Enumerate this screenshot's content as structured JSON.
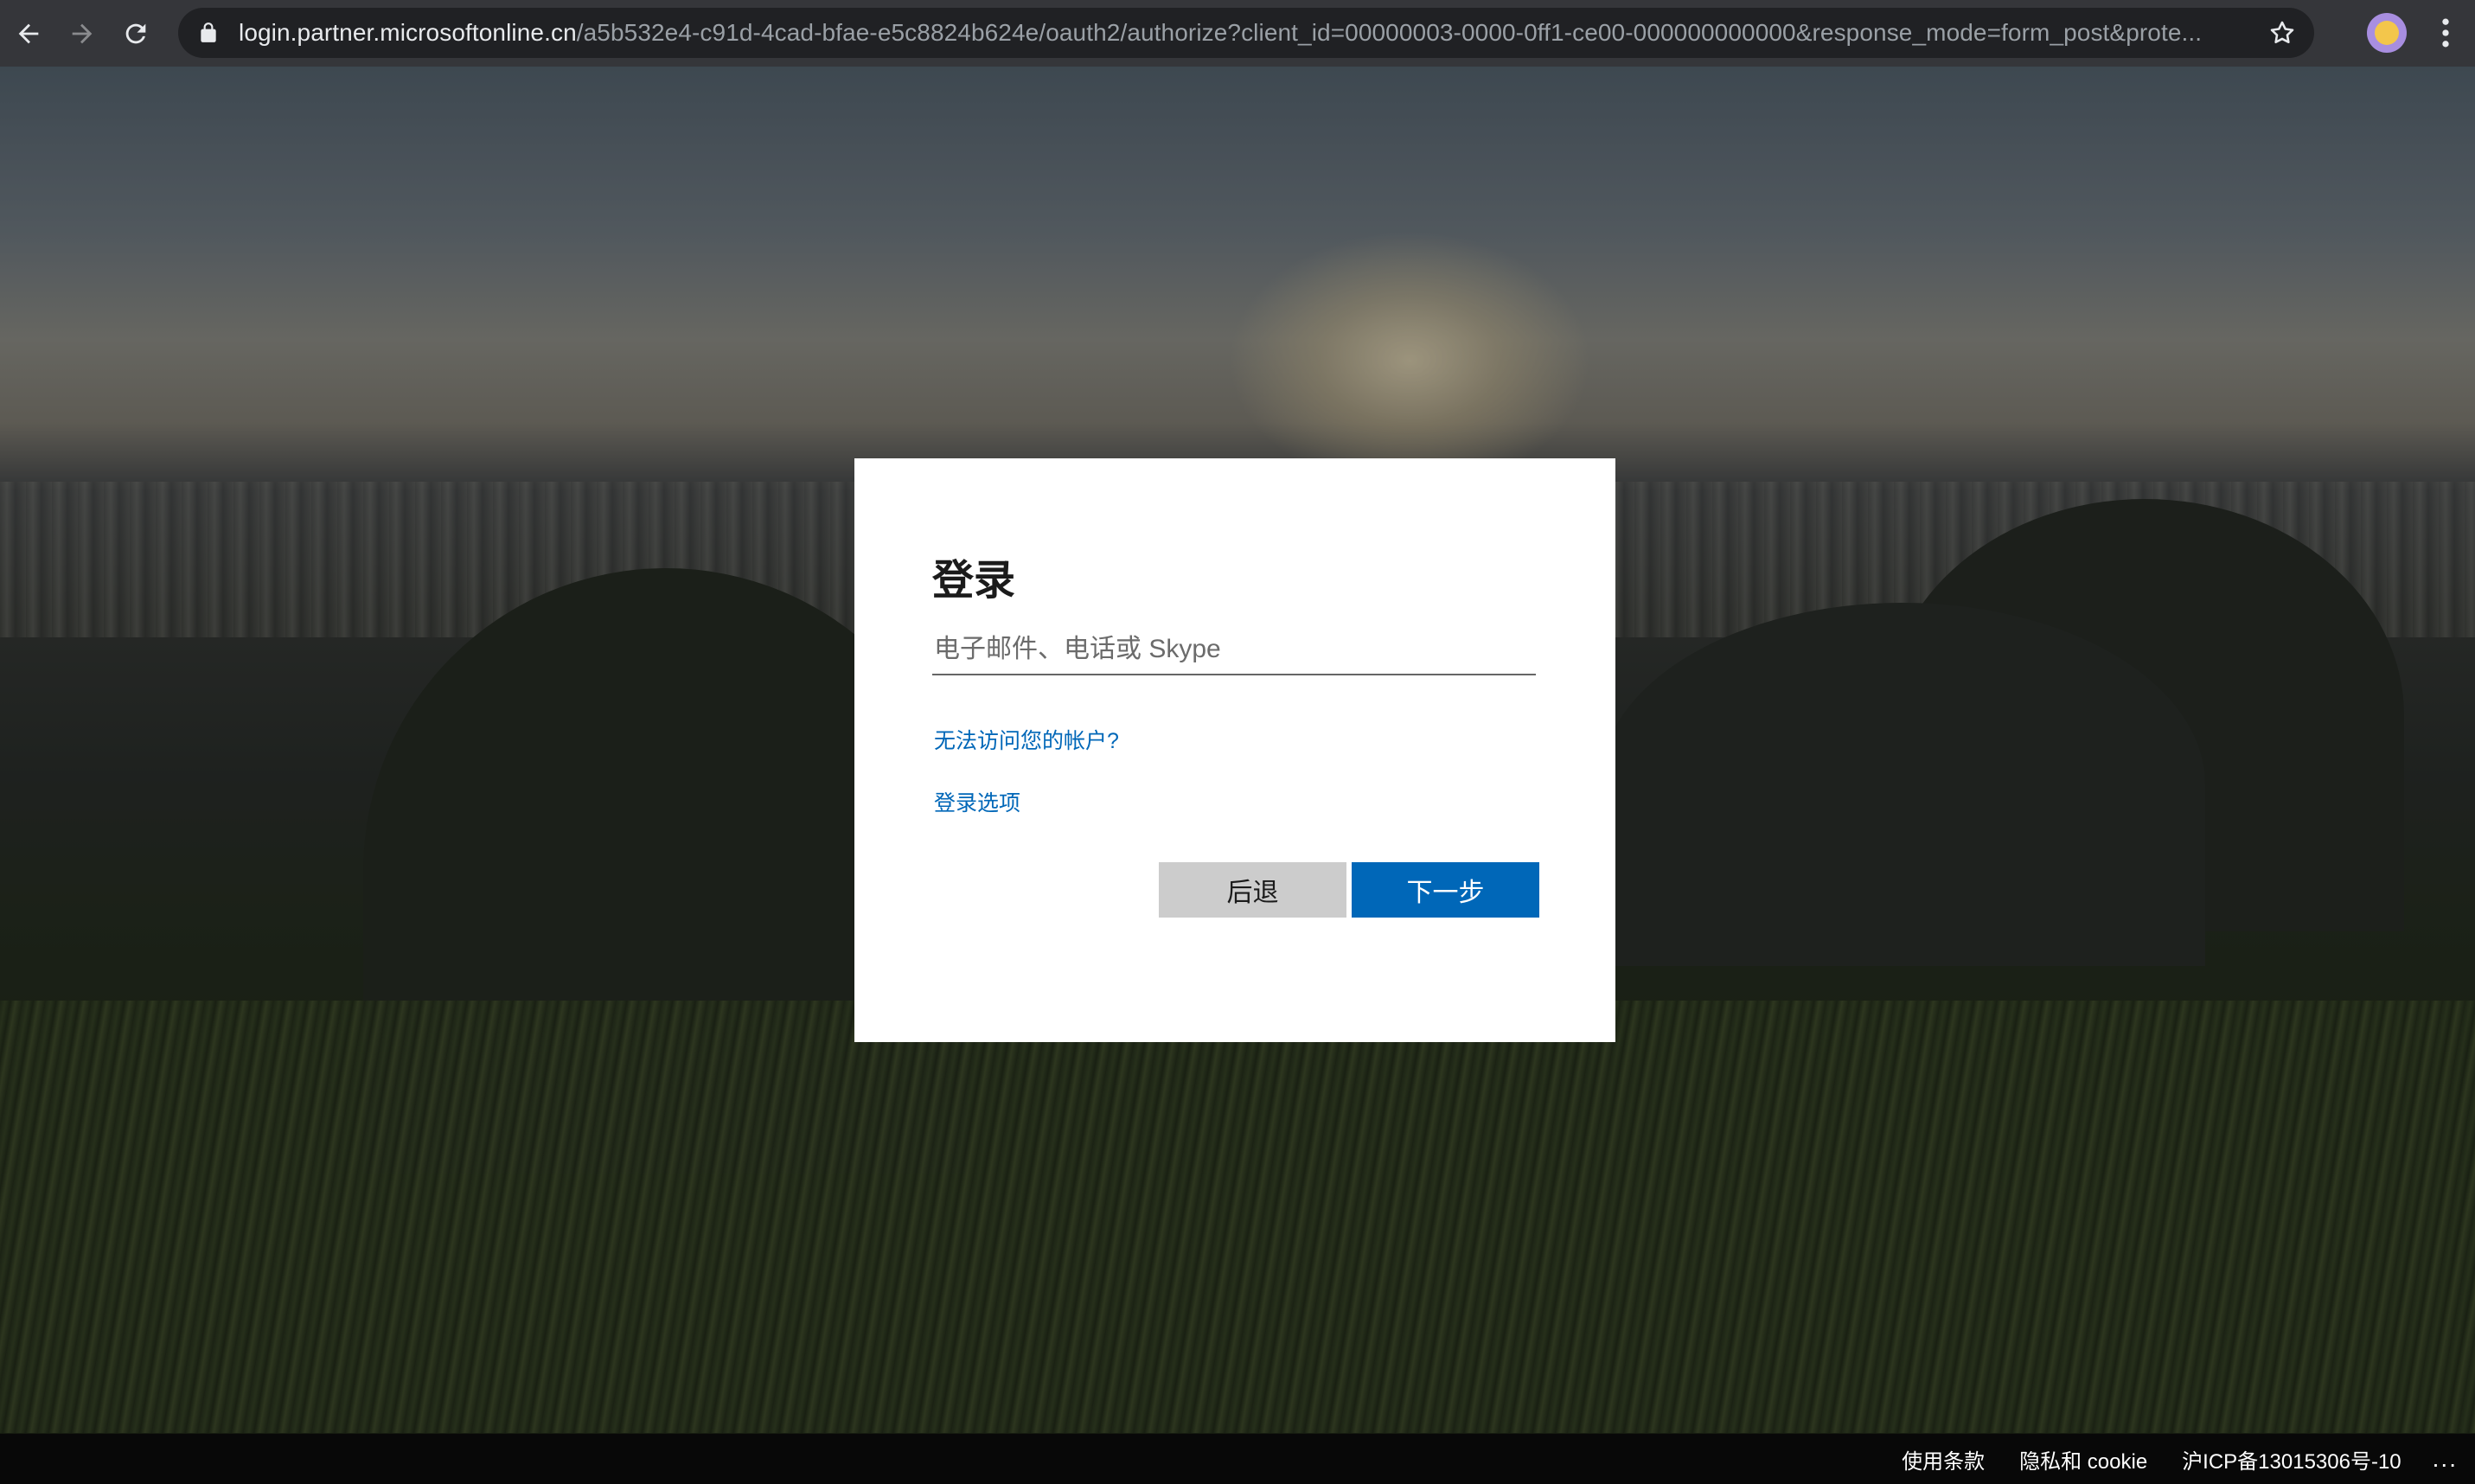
{
  "browser": {
    "url_host": "login.partner.microsoftonline.cn",
    "url_rest": "/a5b532e4-c91d-4cad-bfae-e5c8824b624e/oauth2/authorize?client_id=00000003-0000-0ff1-ce00-000000000000&response_mode=form_post&prote..."
  },
  "login": {
    "title": "登录",
    "email_placeholder": "电子邮件、电话或 Skype",
    "email_value": "",
    "cant_access": "无法访问您的帐户?",
    "signin_options": "登录选项",
    "back_label": "后退",
    "next_label": "下一步"
  },
  "footer": {
    "terms": "使用条款",
    "privacy": "隐私和 cookie",
    "icp": "沪ICP备13015306号-10",
    "more": "..."
  },
  "colors": {
    "accent": "#0067b8",
    "back_button": "#cccccc",
    "chrome": "#35363a"
  },
  "icons": [
    "back-arrow-icon",
    "forward-arrow-icon",
    "reload-icon",
    "lock-icon",
    "star-icon",
    "profile-avatar",
    "kebab-menu-icon"
  ]
}
